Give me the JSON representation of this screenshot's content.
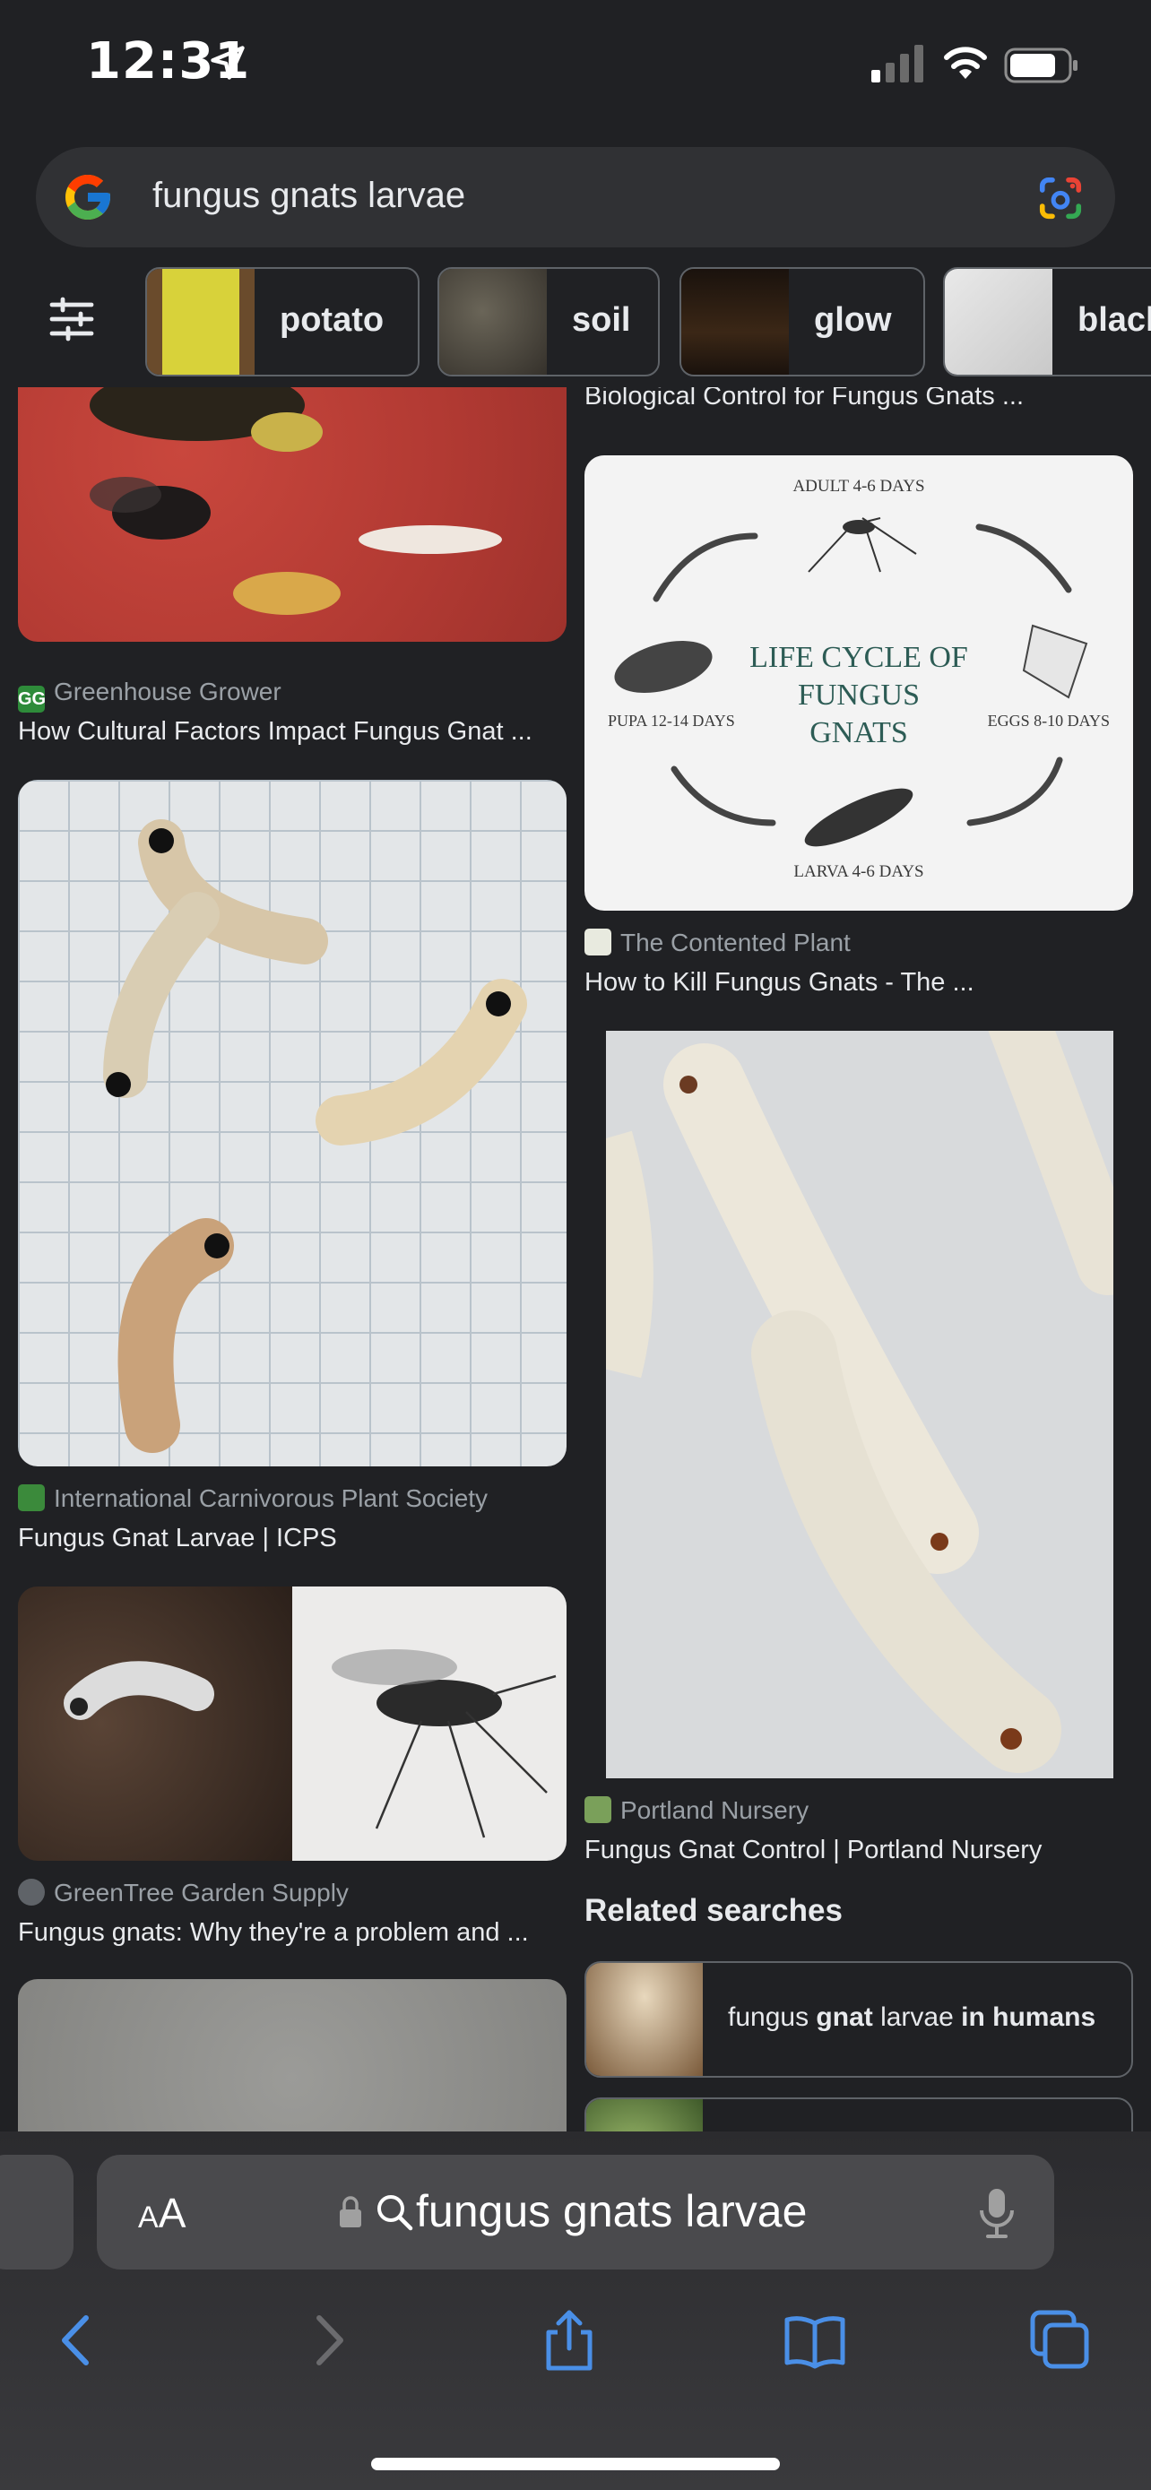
{
  "status": {
    "time": "12:31"
  },
  "search": {
    "query": "fungus gnats larvae"
  },
  "chips": [
    {
      "label": "potato"
    },
    {
      "label": "soil"
    },
    {
      "label": "glow"
    },
    {
      "label": "black"
    }
  ],
  "results": {
    "top_right_title": "Biological Control for Fungus Gnats ...",
    "items": [
      {
        "source": "Greenhouse Grower",
        "title": "How Cultural Factors Impact Fungus Gnat ..."
      },
      {
        "source": "The Contented Plant",
        "title": "How to Kill Fungus Gnats - The ..."
      },
      {
        "source": "International Carnivorous Plant Society",
        "title": "Fungus Gnat Larvae | ICPS"
      },
      {
        "source": "GreenTree Garden Supply",
        "title": "Fungus gnats: Why they're a problem and ..."
      },
      {
        "source": "Portland Nursery",
        "title": "Fungus Gnat Control | Portland Nursery"
      }
    ],
    "lifecycle": {
      "title_line1": "LIFE CYCLE OF",
      "title_line2": "FUNGUS",
      "title_line3": "GNATS",
      "adult": "ADULT 4-6 DAYS",
      "eggs": "EGGS 8-10 DAYS",
      "larva": "LARVA 4-6 DAYS",
      "pupa": "PUPA 12-14 DAYS"
    }
  },
  "related": {
    "title": "Related searches",
    "items": [
      {
        "prefix": "fungus ",
        "bold1": "gnat",
        "middle": " larvae ",
        "bold2": "in humans"
      }
    ]
  },
  "browser": {
    "aa_small": "A",
    "aa_large": "A",
    "url": "fungus gnats larvae"
  },
  "colors": {
    "background": "#202124",
    "accent": "#4a8fe7"
  }
}
